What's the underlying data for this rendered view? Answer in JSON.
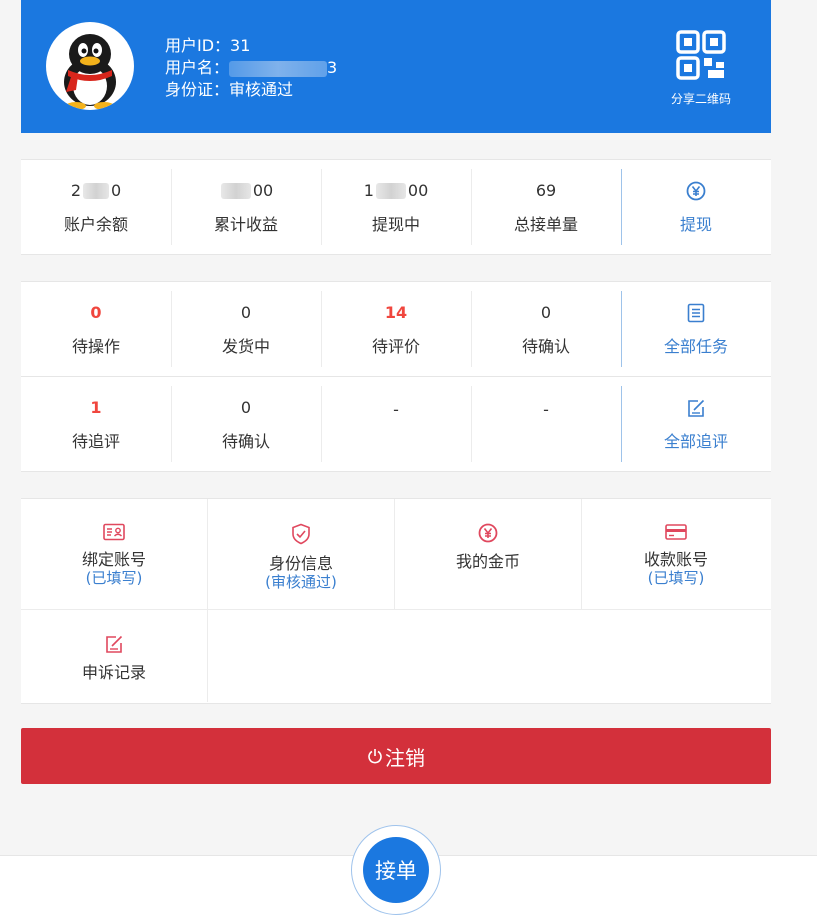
{
  "header": {
    "user_id_label": "用户ID：",
    "user_id": "31",
    "username_label": "用户名：",
    "username_tail": "3",
    "id_card_label": "身份证：",
    "id_card_status": "审核通过",
    "qr_label": "分享二维码"
  },
  "stats": [
    {
      "prefix": "2",
      "suffix": "0",
      "label": "账户余额"
    },
    {
      "prefix": "",
      "suffix": "00",
      "label": "累计收益"
    },
    {
      "prefix": "1",
      "suffix": "00",
      "label": "提现中"
    },
    {
      "prefix": "",
      "suffix": "69",
      "label": "总接单量"
    }
  ],
  "withdraw": {
    "label": "提现",
    "icon": "yen-circle-icon"
  },
  "tasks_row1": [
    {
      "value": "0",
      "label": "待操作",
      "highlight": true
    },
    {
      "value": "0",
      "label": "发货中",
      "highlight": false
    },
    {
      "value": "14",
      "label": "待评价",
      "highlight": true
    },
    {
      "value": "0",
      "label": "待确认",
      "highlight": false
    }
  ],
  "all_tasks": {
    "label": "全部任务",
    "icon": "list-icon"
  },
  "tasks_row2": [
    {
      "value": "1",
      "label": "待追评",
      "highlight": true
    },
    {
      "value": "0",
      "label": "待确认",
      "highlight": false
    },
    {
      "value": "-",
      "label": "",
      "highlight": false
    },
    {
      "value": "-",
      "label": "",
      "highlight": false
    }
  ],
  "all_followups": {
    "label": "全部追评",
    "icon": "edit-icon"
  },
  "tools": [
    {
      "label": "绑定账号",
      "sub": "(已填写)",
      "icon": "id-card-icon"
    },
    {
      "label": "身份信息",
      "sub": "(审核通过)",
      "icon": "shield-check-icon"
    },
    {
      "label": "我的金币",
      "sub": "",
      "icon": "coin-icon"
    },
    {
      "label": "收款账号",
      "sub": "(已填写)",
      "icon": "credit-card-icon"
    },
    {
      "label": "申诉记录",
      "sub": "",
      "icon": "edit-icon"
    }
  ],
  "logout": {
    "label": "注销",
    "icon": "power-icon"
  },
  "fab": {
    "label": "接单"
  },
  "colors": {
    "primary": "#1b78e0",
    "danger": "#d3303b",
    "highlight": "#f0463e",
    "link": "#3a7fcf"
  }
}
